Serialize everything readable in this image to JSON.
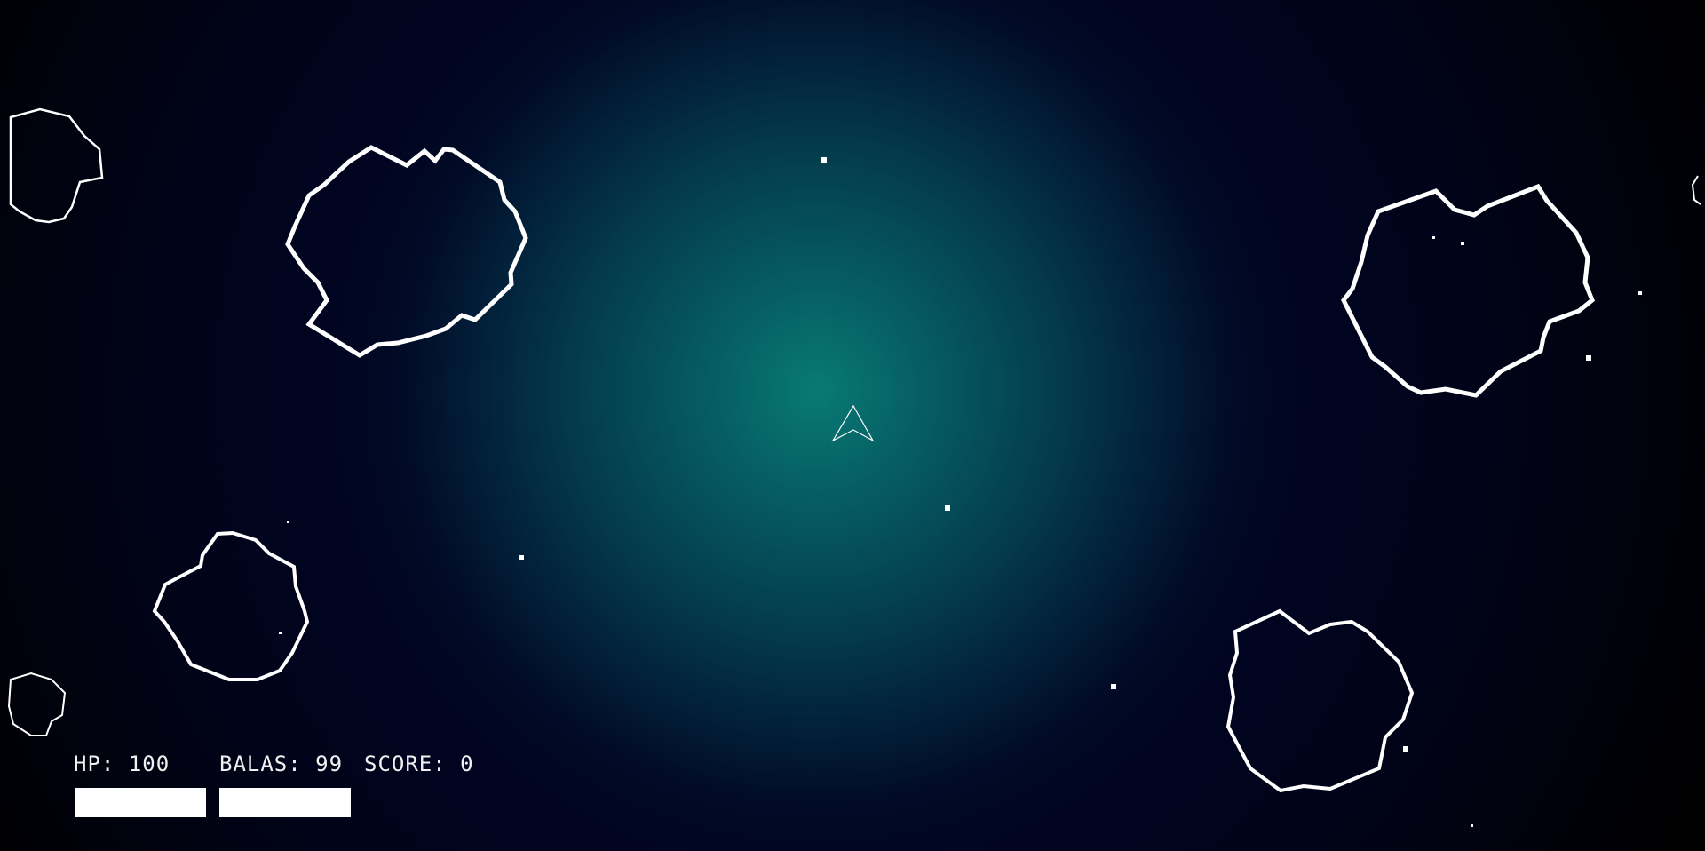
{
  "hud": {
    "hp_label": "HP:",
    "hp_value": "100",
    "ammo_label": "BALAS:",
    "ammo_value": "99",
    "score_label": "SCORE:",
    "score_value": "0",
    "hp_fraction": 1.0,
    "ammo_fraction": 1.0
  },
  "colors": {
    "nebula_core": "#087a74",
    "space": "#010318",
    "outline": "#ffffff",
    "hud_text": "#f1f1f1"
  }
}
